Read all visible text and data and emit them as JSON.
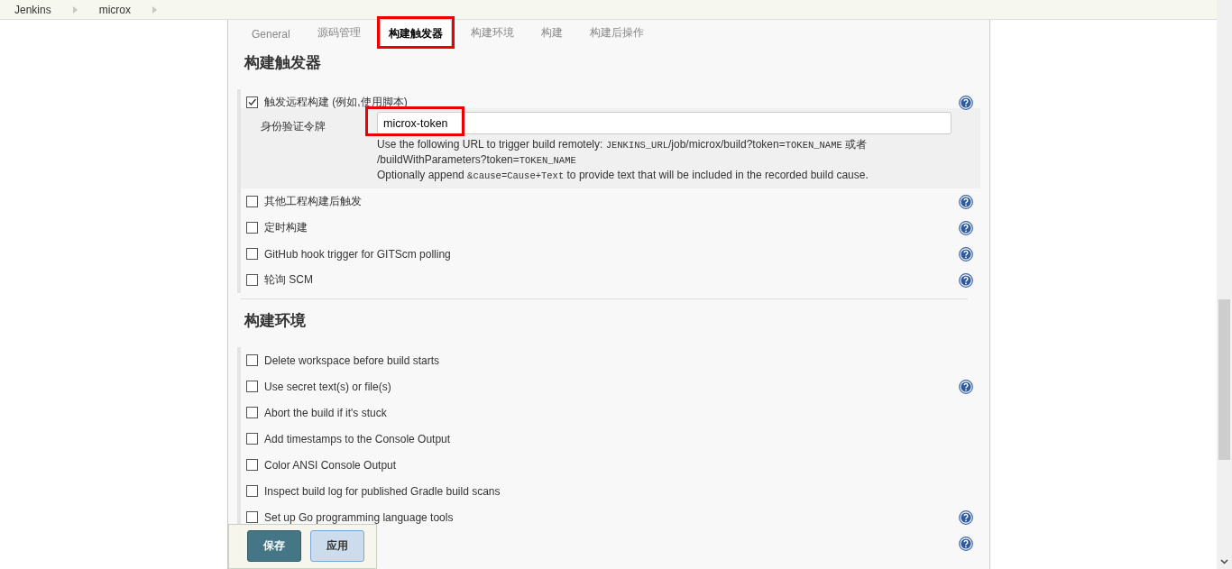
{
  "breadcrumbs": [
    {
      "label": "Jenkins"
    },
    {
      "label": "microx"
    }
  ],
  "tabs": [
    {
      "label": "General",
      "selected": false,
      "highlighted": false
    },
    {
      "label": "源码管理",
      "selected": false,
      "highlighted": false
    },
    {
      "label": "构建触发器",
      "selected": true,
      "highlighted": true
    },
    {
      "label": "构建环境",
      "selected": false,
      "highlighted": false
    },
    {
      "label": "构建",
      "selected": false,
      "highlighted": false
    },
    {
      "label": "构建后操作",
      "selected": false,
      "highlighted": false
    }
  ],
  "sections": [
    {
      "title": "构建触发器",
      "options": [
        {
          "label": "触发远程构建 (例如,使用脚本)",
          "checked": true,
          "help": true,
          "field": {
            "label": "身份验证令牌",
            "value": "microx-token",
            "highlighted": true,
            "hint": [
              {
                "text": "Use the following URL to trigger build remotely: ",
                "kind": "plain"
              },
              {
                "text": "JENKINS_URL",
                "kind": "code"
              },
              {
                "text": "/job/microx/build?token=",
                "kind": "plain"
              },
              {
                "text": "TOKEN_NAME",
                "kind": "code"
              },
              {
                "text": " 或者 /buildWithParameters?token=",
                "kind": "plain"
              },
              {
                "text": "TOKEN_NAME",
                "kind": "code"
              }
            ],
            "hint2": [
              {
                "text": "Optionally append ",
                "kind": "plain"
              },
              {
                "text": "&cause=Cause+Text",
                "kind": "code"
              },
              {
                "text": " to provide text that will be included in the recorded build cause.",
                "kind": "plain"
              }
            ]
          }
        },
        {
          "label": "其他工程构建后触发",
          "checked": false,
          "help": true
        },
        {
          "label": "定时构建",
          "checked": false,
          "help": true
        },
        {
          "label": "GitHub hook trigger for GITScm polling",
          "checked": false,
          "help": true
        },
        {
          "label": "轮询 SCM",
          "checked": false,
          "help": true
        }
      ]
    },
    {
      "title": "构建环境",
      "options": [
        {
          "label": "Delete workspace before build starts",
          "checked": false,
          "help": false
        },
        {
          "label": "Use secret text(s) or file(s)",
          "checked": false,
          "help": true
        },
        {
          "label": "Abort the build if it's stuck",
          "checked": false,
          "help": false
        },
        {
          "label": "Add timestamps to the Console Output",
          "checked": false,
          "help": false
        },
        {
          "label": "Color ANSI Console Output",
          "checked": false,
          "help": false
        },
        {
          "label": "Inspect build log for published Gradle build scans",
          "checked": false,
          "help": false
        },
        {
          "label": "Set up Go programming language tools",
          "checked": false,
          "help": true
        },
        {
          "help": true
        }
      ]
    }
  ],
  "buttons": [
    {
      "label": "保存",
      "kind": "primary"
    },
    {
      "label": "应用",
      "kind": "secondary"
    }
  ]
}
